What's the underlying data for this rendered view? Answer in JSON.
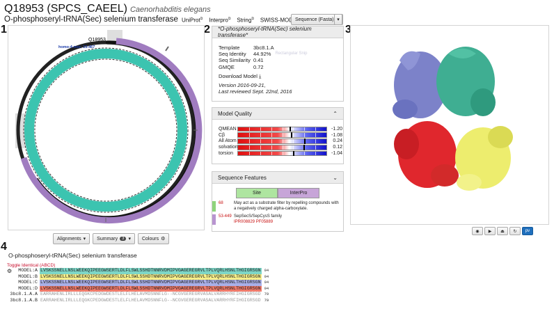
{
  "header": {
    "title": "Q18953 (SPCS_CAEEL)",
    "species": "Caenorhabditis elegans",
    "subtitle": "O-phosphoseryl-tRNA(Sec) selenium transferase",
    "links": [
      "UniProt",
      "Interpro",
      "String",
      "SWISS-MODEL"
    ],
    "seq_button": "Sequence (Fasta)"
  },
  "panels": {
    "n1": "1",
    "n2": "2",
    "n3": "3",
    "n4": "4"
  },
  "map": {
    "id_label": "Q18953",
    "oligo_label": "homo-4-mer; 15-467"
  },
  "model_info": {
    "title": "*O-phosphoseryl-tRNA(Sec) selenium transferase*",
    "template_k": "Template",
    "template_v": "3bc8.1.A",
    "identity_k": "Seq Identity",
    "identity_v": "44.92%",
    "similarity_k": "Seq Similarity",
    "similarity_v": "0.41",
    "gmqe_k": "GMQE",
    "gmqe_v": "0.72",
    "faint": "Rectangular Snip",
    "download": "Download Model",
    "version": "Version 2016-09-21,",
    "reviewed": "Last reviewed Sept. 22nd, 2016"
  },
  "quality": {
    "title": "Model Quality",
    "rows": [
      {
        "label": "QMEAN",
        "value": "-1.20",
        "pos": 0.58
      },
      {
        "label": "Cβ",
        "value": "-1.08",
        "pos": 0.6
      },
      {
        "label": "All Atom",
        "value": "0.24",
        "pos": 0.75
      },
      {
        "label": "solvation",
        "value": "0.12",
        "pos": 0.74
      },
      {
        "label": "torsion",
        "value": "-1.04",
        "pos": 0.62
      }
    ]
  },
  "features": {
    "title": "Sequence Features",
    "tab_site": "Site",
    "tab_interpro": "InterPro",
    "site_num": "68",
    "site_text": "May act as a substrate filter by repelling compounds with a negatively charged alpha-carboxylate.",
    "ip_num": "53-449",
    "ip_text": "SepSecS/SepCysS family",
    "ip_ids": "IPR008829 PF05889"
  },
  "controls": {
    "alignments": "Alignments",
    "summary": "Summary",
    "summary_badge": "3",
    "colours": "Colours"
  },
  "alignment": {
    "title": "O-phosphoseryl-tRNA(Sec) selenium transferase",
    "toggle": "Toggle Identical (ABCD)",
    "rows": [
      {
        "name": "MODEL:A",
        "seq": "LVSKSSNELLNSLWEEKQIPEEGWSERTLDLFLSWLSSHDTNNRVDMIPVGAGEREGRVLTPLVQRLHSNLTHGIGRSGN",
        "end": "94",
        "cls": "sqA"
      },
      {
        "name": "MODEL:B",
        "seq": "LVSKSSNELLNSLWEEKQIPEEGWSERTLDLFLSWLSSHDTNNRVDMIPVGAGEREGRVLTPLVQRLHSNLTHGIGRSGN",
        "end": "94",
        "cls": "sqB"
      },
      {
        "name": "MODEL:C",
        "seq": "LVSKSSNELLNSLWEEKQIPEEGWSERTLDLFLSWLSSHDTNNRVDMIPVGAGEREGRVLTPLVQRLHSNLTHGIGRSGN",
        "end": "94",
        "cls": "sqC"
      },
      {
        "name": "MODEL:D",
        "seq": "LVSKSSNELLNSLWEEKQIPEEGWSERTLDLFLSWLSSHDTNNRVDMIPVGAGEREGRVLTPLVQRLHSNLTHGIGRSGN",
        "end": "94",
        "cls": "sqD"
      },
      {
        "name": "3bc8.1.A.A",
        "seq": "EARRAHENLIRLLLEQGKCPEDGWDESTLELFLHELAVMDSNNFLG--NCGVGEREGRVASALVARRHYRFIHGIGRSGD",
        "end": "79",
        "cls": "sqT"
      },
      {
        "name": "3bc8.1.A.B",
        "seq": "EARRAHENLIRLLLEQGKCPEDGWDESTLELFLHELAVMDSNNFLG--NCGVGEREGRVASALVARRHYRFIHGIGRSGD",
        "end": "79",
        "cls": "sqT"
      }
    ]
  }
}
